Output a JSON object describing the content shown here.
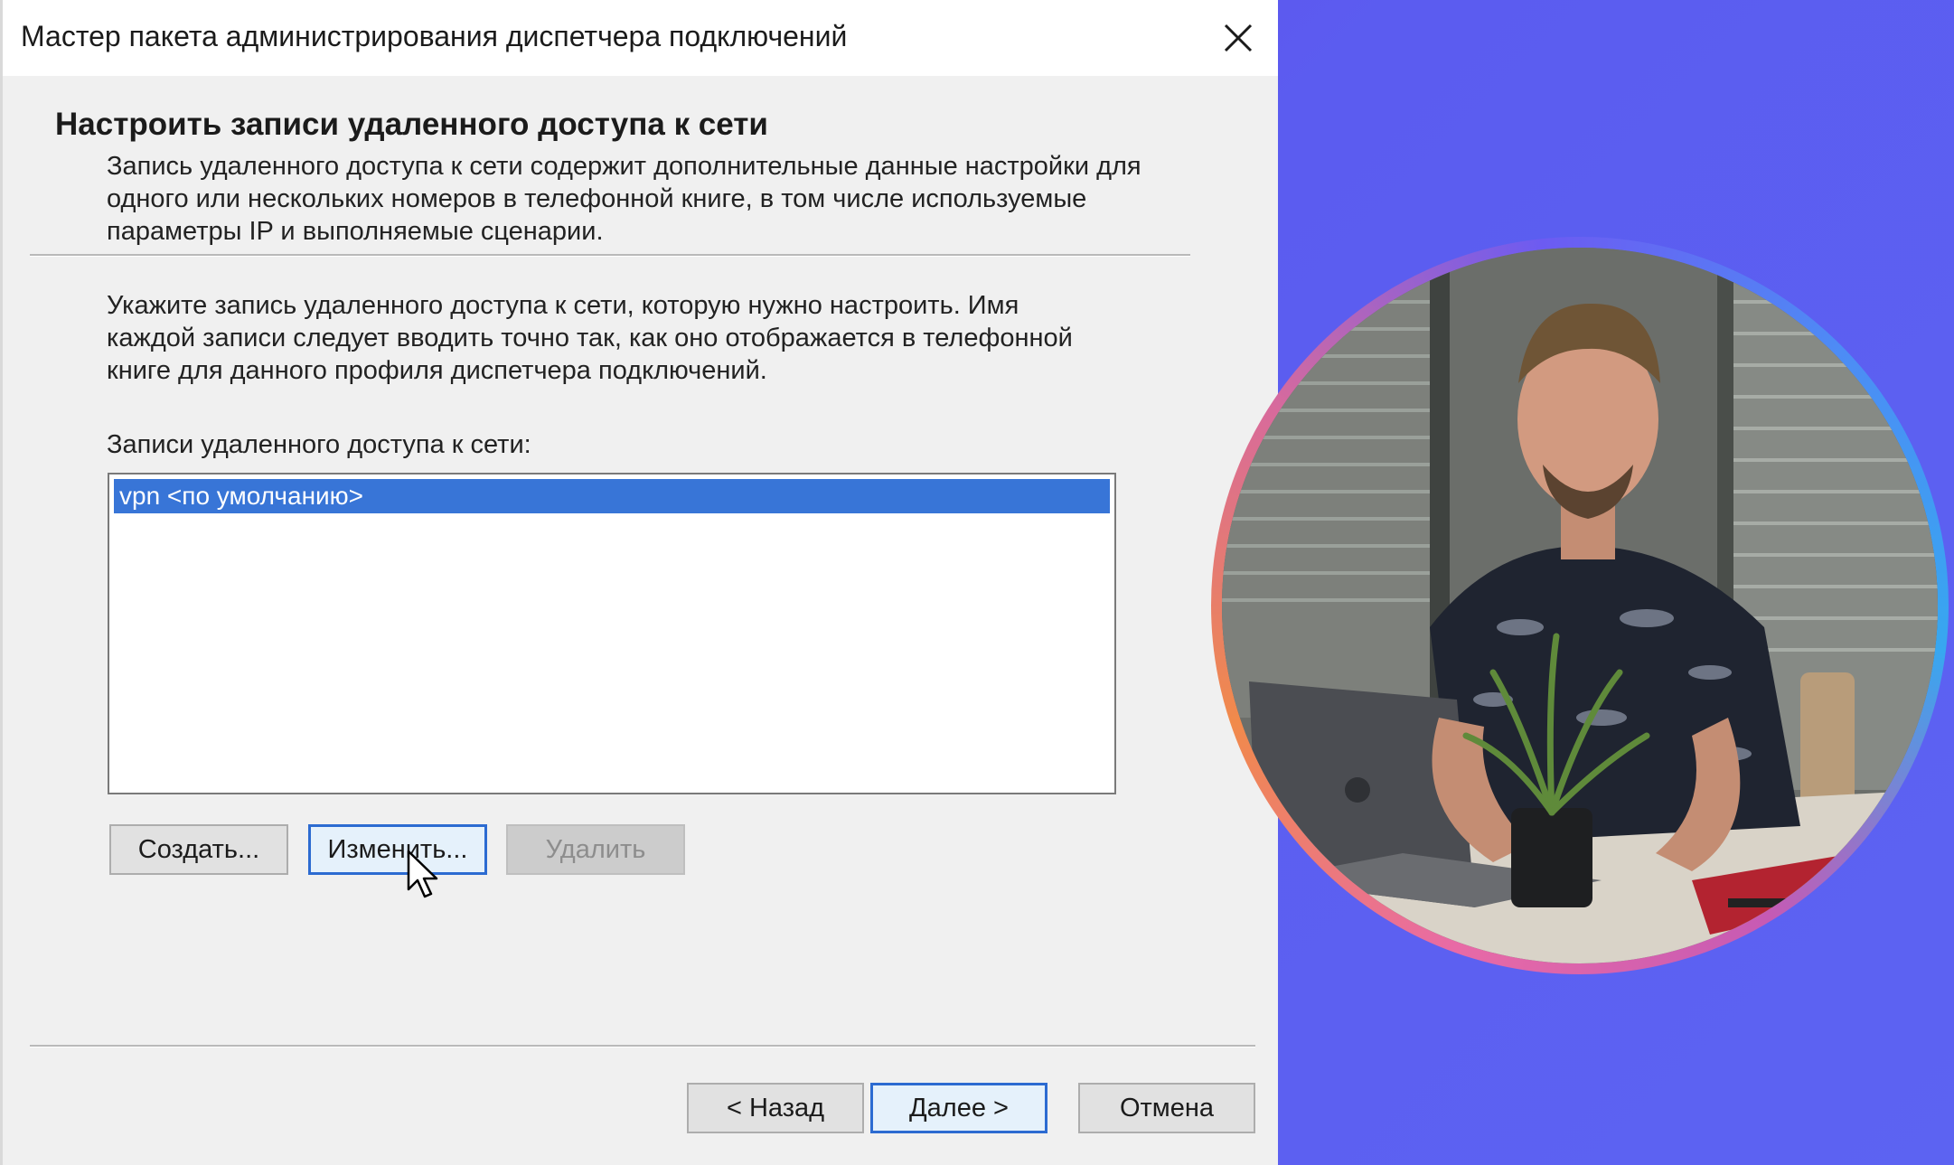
{
  "window": {
    "title": "Мастер пакета администрирования диспетчера подключений"
  },
  "header": {
    "heading": "Настроить записи удаленного доступа к сети",
    "description": "Запись удаленного доступа к сети содержит дополнительные данные настройки для\nодного или нескольких номеров в телефонной книге, в том числе используемые\nпараметры IP и выполняемые сценарии."
  },
  "body": {
    "instruction": "Укажите запись удаленного доступа к сети, которую нужно настроить. Имя\nкаждой записи следует вводить точно так, как оно отображается в телефонной\nкниге для данного профиля диспетчера подключений.",
    "list_label": "Записи удаленного доступа к сети:",
    "entries": [
      {
        "label": "vpn <по умолчанию>",
        "selected": true
      }
    ],
    "buttons": {
      "create": "Создать...",
      "edit": "Изменить...",
      "delete": "Удалить"
    }
  },
  "footer": {
    "back": "< Назад",
    "next": "Далее >",
    "cancel": "Отмена"
  },
  "colors": {
    "selection": "#3875d7",
    "focus_border": "#2c6bd1",
    "background_gradient": "#6a43e6"
  },
  "icons": {
    "close": "close-icon",
    "cursor": "mouse-pointer-icon"
  }
}
